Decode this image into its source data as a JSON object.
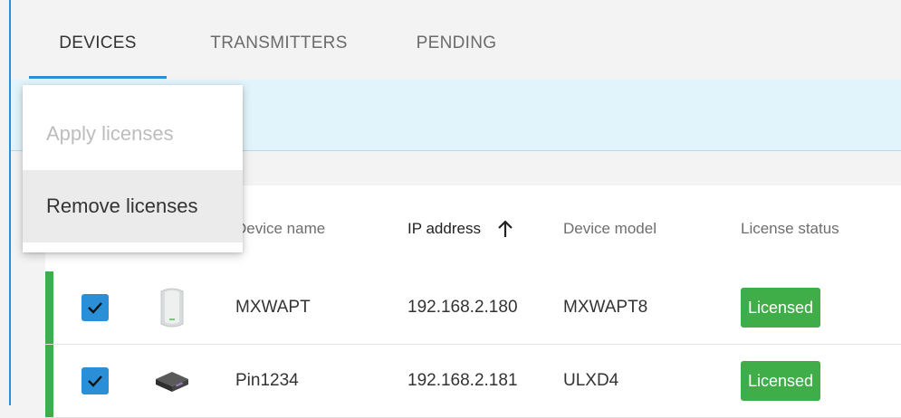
{
  "tabs": [
    {
      "label": "DEVICES",
      "active": true
    },
    {
      "label": "TRANSMITTERS",
      "active": false
    },
    {
      "label": "PENDING",
      "active": false
    }
  ],
  "menu": {
    "items": [
      {
        "label": "Apply licenses",
        "disabled": true
      },
      {
        "label": "Remove licenses",
        "disabled": false,
        "hovered": true
      }
    ]
  },
  "table": {
    "columns": [
      "Device name",
      "IP address",
      "Device model",
      "License status"
    ],
    "sort": {
      "column": "IP address",
      "direction": "ascending",
      "icon": "arrow-up-icon"
    },
    "rows": [
      {
        "selected": true,
        "icon": "access-point-icon",
        "name": "MXWAPT",
        "ip": "192.168.2.180",
        "model": "MXWAPT8",
        "status": "Licensed"
      },
      {
        "selected": true,
        "icon": "receiver-device-icon",
        "name": "Pin1234",
        "ip": "192.168.2.181",
        "model": "ULXD4",
        "status": "Licensed"
      }
    ]
  },
  "colors": {
    "accent": "#2a8fd6",
    "licensed": "#3fae49",
    "action_band": "#e2f4fb"
  }
}
